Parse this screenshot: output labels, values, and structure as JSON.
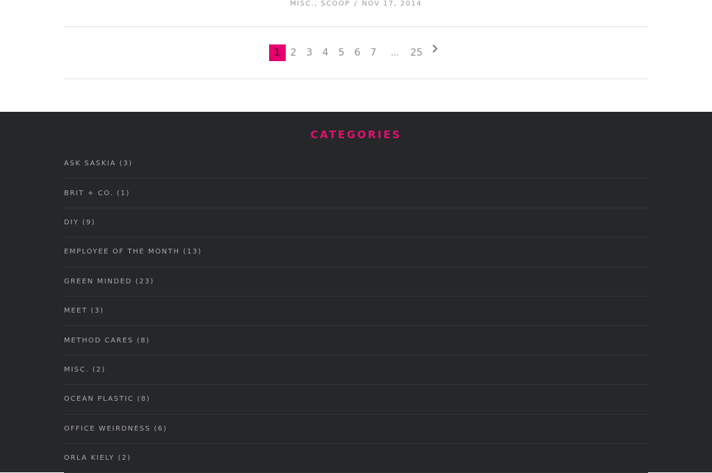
{
  "post_meta": {
    "categories": [
      "MISC.",
      "SCOOP"
    ],
    "separator": "/",
    "date": "NOV 17, 2014"
  },
  "pagination": {
    "pages": [
      "1",
      "2",
      "3",
      "4",
      "5",
      "6",
      "7"
    ],
    "current": "1",
    "ellipsis": "…",
    "last": "25",
    "next_icon": "chevron-right-icon",
    "accent": "#e5006e"
  },
  "categories_widget": {
    "title": "CATEGORIES",
    "title_color": "#e0116e",
    "items": [
      {
        "label": "ASK SASKIA",
        "count": "(3)"
      },
      {
        "label": "BRIT + CO.",
        "count": "(1)"
      },
      {
        "label": "DIY",
        "count": "(9)"
      },
      {
        "label": "EMPLOYEE OF THE MONTH",
        "count": "(13)"
      },
      {
        "label": "GREEN MINDED",
        "count": "(23)"
      },
      {
        "label": "MEET",
        "count": "(3)"
      },
      {
        "label": "METHOD CARES",
        "count": "(8)"
      },
      {
        "label": "MISC.",
        "count": "(2)"
      },
      {
        "label": "OCEAN PLASTIC",
        "count": "(8)"
      },
      {
        "label": "OFFICE WEIRDNESS",
        "count": "(6)"
      },
      {
        "label": "ORLA KIELY",
        "count": "(2)"
      }
    ]
  }
}
